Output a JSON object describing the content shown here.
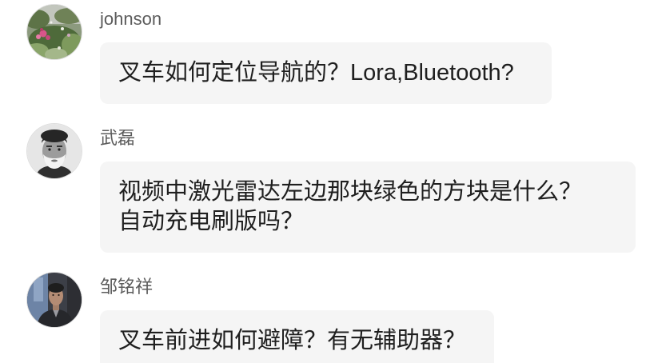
{
  "colors": {
    "background": "#ffffff",
    "bubble_background": "#f5f5f5",
    "username_text": "#5c5c5c",
    "message_text": "#1f1f1f"
  },
  "comments": [
    {
      "username": "johnson",
      "message_lines": [
        "叉车如何定位导航的？Lora,Bluetooth?"
      ]
    },
    {
      "username": "武磊",
      "message_lines": [
        "视频中激光雷达左边那块绿色的方块是什么？",
        "自动充电刷版吗？"
      ]
    },
    {
      "username": "邹铭祥",
      "message_lines": [
        "叉车前进如何避障？有无辅助器？"
      ]
    }
  ]
}
